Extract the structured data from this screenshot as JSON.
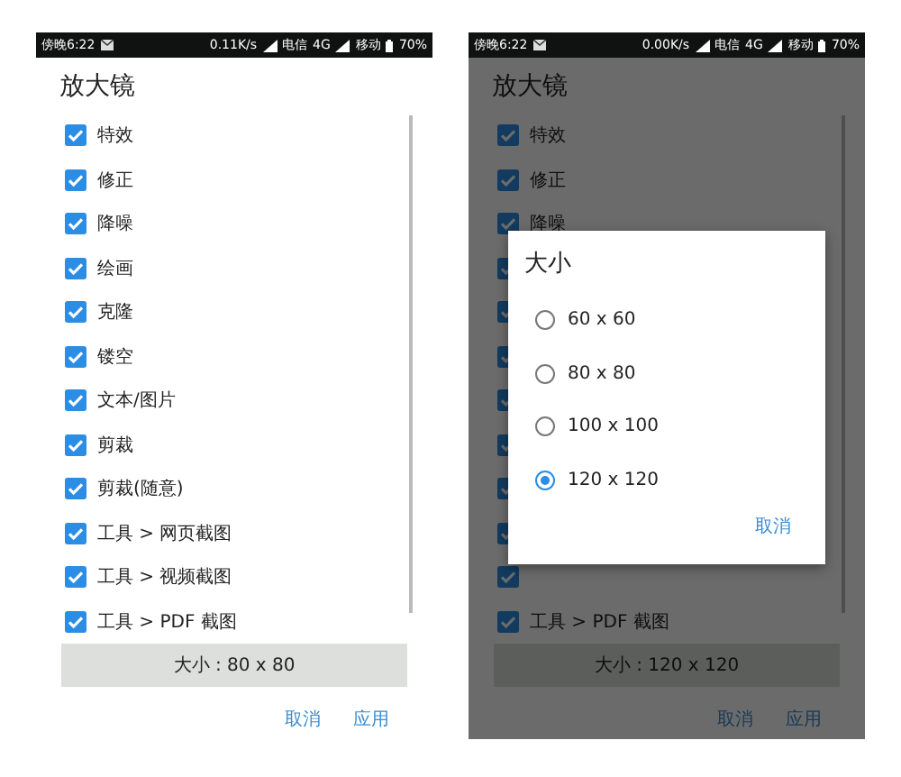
{
  "screens": [
    {
      "status_bar": {
        "time": "傍晚6:22",
        "speed": "0.11K/s",
        "carrier_1": "电信",
        "network": "4G",
        "carrier_2": "移动",
        "battery": "70%"
      },
      "dimmed": false,
      "dialog": {
        "title": "放大镜",
        "options": [
          {
            "label": "特效",
            "checked": true
          },
          {
            "label": "修正",
            "checked": true
          },
          {
            "label": "降噪",
            "checked": true
          },
          {
            "label": "绘画",
            "checked": true
          },
          {
            "label": "克隆",
            "checked": true
          },
          {
            "label": "镂空",
            "checked": true
          },
          {
            "label": "文本/图片",
            "checked": true
          },
          {
            "label": "剪裁",
            "checked": true
          },
          {
            "label": "剪裁(随意)",
            "checked": true
          },
          {
            "label": "工具 > 网页截图",
            "checked": true
          },
          {
            "label": "工具 > 视频截图",
            "checked": true
          },
          {
            "label": "工具 > PDF 截图",
            "checked": true
          }
        ],
        "size_button": "大小 : 80 x 80",
        "buttons": [
          "取消",
          "应用"
        ]
      }
    },
    {
      "status_bar": {
        "time": "傍晚6:22",
        "speed": "0.00K/s",
        "carrier_1": "电信",
        "network": "4G",
        "carrier_2": "移动",
        "battery": "70%"
      },
      "dimmed": true,
      "dialog": {
        "title": "放大镜",
        "options": [
          {
            "label": "特效",
            "checked": true
          },
          {
            "label": "修正",
            "checked": true
          },
          {
            "label": "降噪",
            "checked": true
          },
          {
            "checked": true
          },
          {
            "checked": true
          },
          {
            "checked": true
          },
          {
            "checked": true
          },
          {
            "checked": true
          },
          {
            "checked": true
          },
          {
            "checked": true
          },
          {
            "checked": true
          },
          {
            "label": "工具 > PDF 截图",
            "checked": true
          }
        ],
        "size_button": "大小 : 120 x 120",
        "buttons": [
          "取消",
          "应用"
        ]
      },
      "popup": {
        "title": "大小",
        "options": [
          {
            "label": "60 x 60",
            "selected": false
          },
          {
            "label": "80 x 80",
            "selected": false
          },
          {
            "label": "100 x 100",
            "selected": false
          },
          {
            "label": "120 x 120",
            "selected": true
          }
        ],
        "button": "取消"
      }
    }
  ]
}
